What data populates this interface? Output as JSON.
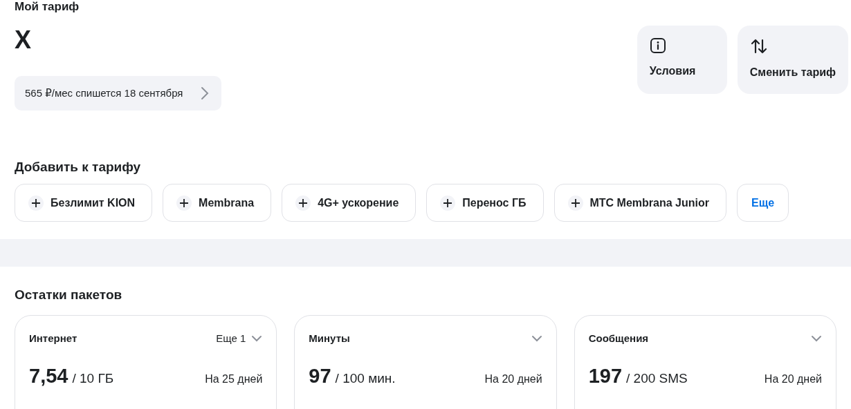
{
  "page_title": "Мой тариф",
  "tariff_name": "X",
  "billing": "565 ₽/мес спишется 18 сентября",
  "actions": [
    {
      "label": "Условия",
      "kind": "info"
    },
    {
      "label": "Сменить тариф",
      "kind": "swap"
    }
  ],
  "addons": {
    "heading": "Добавить к тарифу",
    "items": [
      "Безлимит KION",
      "Membrana",
      "4G+ ускорение",
      "Перенос ГБ",
      "МТС Membrana Junior"
    ],
    "more": "Еще"
  },
  "packages": {
    "heading": "Остатки пакетов",
    "cards": [
      {
        "title": "Интернет",
        "more": "Еще 1",
        "amount": "7,54",
        "total": "/ 10 ГБ",
        "period": "На 25 дней"
      },
      {
        "title": "Минуты",
        "amount": "97",
        "total": "/ 100 мин.",
        "period": "На 20 дней"
      },
      {
        "title": "Сообщения",
        "amount": "197",
        "total": "/ 200 SMS",
        "period": "На 20 дней"
      }
    ]
  }
}
